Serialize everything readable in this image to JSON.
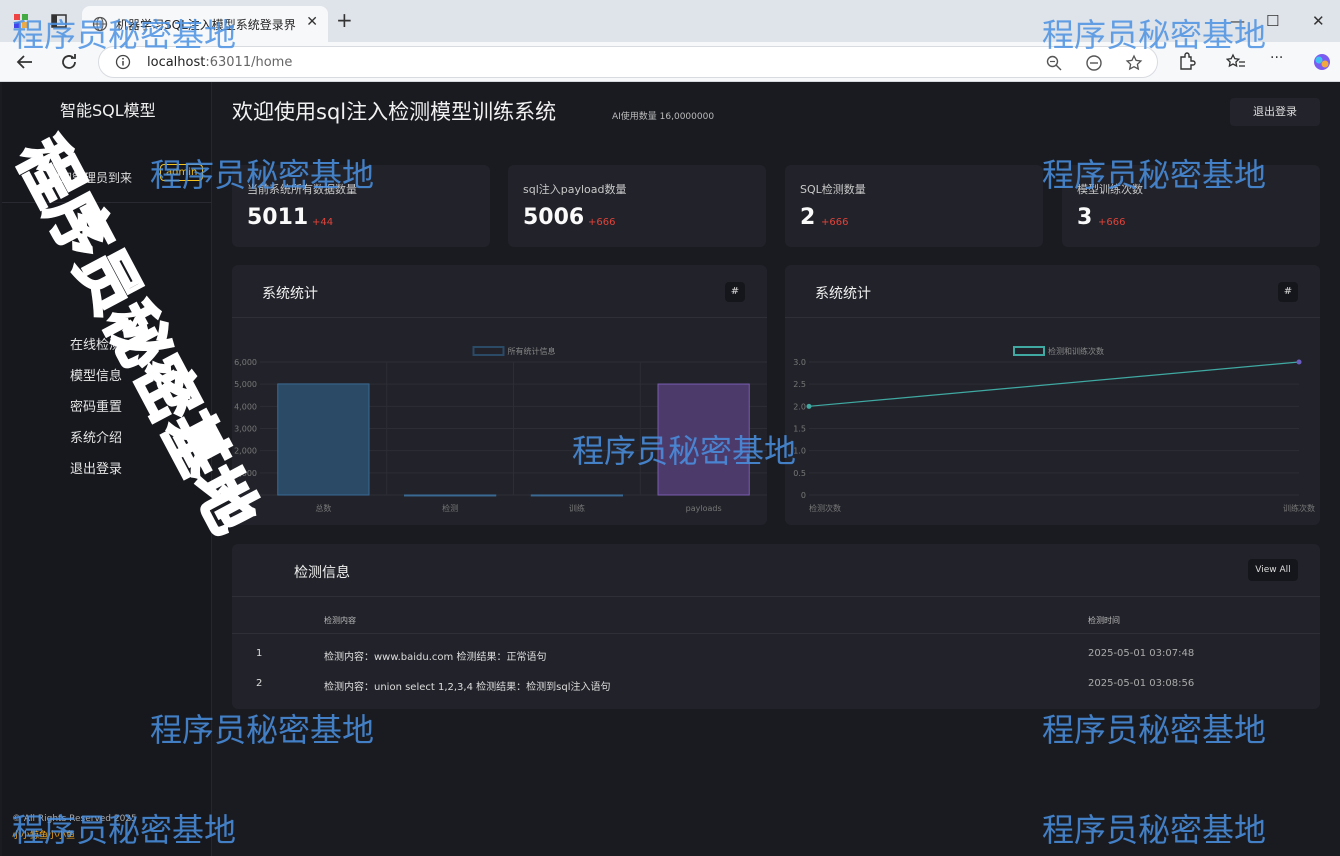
{
  "browser": {
    "tab_title": "机器学习SQL注入模型系统登录界",
    "url_host": "localhost",
    "url_rest": ":63011/home"
  },
  "sidebar": {
    "brand": "智能SQL模型",
    "welcome": "欢迎管理员到来",
    "user_tag": "admin",
    "menu": [
      "在线检测",
      "模型信息",
      "密码重置",
      "系统介绍",
      "退出登录"
    ],
    "footer_copy": "© All Rights Reserved 2025",
    "footer_link": "小小鲸鱼小小鱼"
  },
  "header": {
    "title": "欢迎使用sql注入检测模型训练系统",
    "ai_count": "AI使用数量 16,0000000",
    "logout": "退出登录"
  },
  "cards": [
    {
      "label": "当前系统所有数据数量",
      "value": "5011",
      "delta": "+44"
    },
    {
      "label": "sql注入payload数量",
      "value": "5006",
      "delta": "+666"
    },
    {
      "label": "SQL检测数量",
      "value": "2",
      "delta": "+666"
    },
    {
      "label": "模型训练次数",
      "value": "3",
      "delta": "+666"
    }
  ],
  "panel_left": {
    "title": "系统统计",
    "hash": "#"
  },
  "panel_right": {
    "title": "系统统计",
    "hash": "#"
  },
  "chart_data": [
    {
      "type": "bar",
      "title": "",
      "legend": "所有统计信息",
      "categories": [
        "总数",
        "检测",
        "训练",
        "payloads"
      ],
      "values": [
        5011,
        2,
        3,
        5006
      ],
      "yticks": [
        "0",
        "1,000",
        "2,000",
        "3,000",
        "4,000",
        "5,000",
        "6,000"
      ],
      "ylim": [
        0,
        6000
      ],
      "colors": [
        "#2b4a66",
        "#2b4a66",
        "#2b4a66",
        "#4c3a6b"
      ],
      "grid": true
    },
    {
      "type": "line",
      "title": "",
      "legend": "检测和训练次数",
      "categories": [
        "检测次数",
        "训练次数"
      ],
      "values": [
        2,
        3
      ],
      "yticks": [
        "0",
        "0.5",
        "1.0",
        "1.5",
        "2.0",
        "2.5",
        "3.0"
      ],
      "ylim": [
        0,
        3
      ],
      "color": "#3fa9a2",
      "grid": true
    }
  ],
  "table": {
    "title": "检测信息",
    "view_all": "View All",
    "headers": [
      "检测内容",
      "检测时间"
    ],
    "rows": [
      {
        "id": "1",
        "content": "检测内容：www.baidu.com 检测结果：正常语句",
        "time": "2025-05-01 03:07:48"
      },
      {
        "id": "2",
        "content": "检测内容：union select 1,2,3,4 检测结果：检测到sql注入语句",
        "time": "2025-05-01 03:08:56"
      }
    ]
  },
  "watermark": {
    "text": "程序员秘密基地"
  }
}
